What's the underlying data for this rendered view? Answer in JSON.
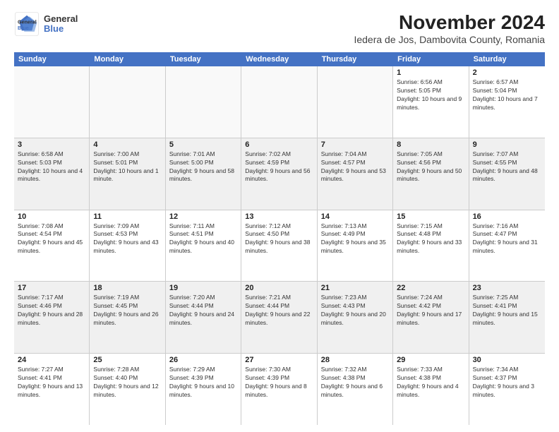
{
  "header": {
    "logo_general": "General",
    "logo_blue": "Blue",
    "title": "November 2024",
    "subtitle": "Iedera de Jos, Dambovita County, Romania"
  },
  "weekdays": [
    "Sunday",
    "Monday",
    "Tuesday",
    "Wednesday",
    "Thursday",
    "Friday",
    "Saturday"
  ],
  "rows": [
    [
      {
        "day": "",
        "info": ""
      },
      {
        "day": "",
        "info": ""
      },
      {
        "day": "",
        "info": ""
      },
      {
        "day": "",
        "info": ""
      },
      {
        "day": "",
        "info": ""
      },
      {
        "day": "1",
        "info": "Sunrise: 6:56 AM\nSunset: 5:05 PM\nDaylight: 10 hours and 9 minutes."
      },
      {
        "day": "2",
        "info": "Sunrise: 6:57 AM\nSunset: 5:04 PM\nDaylight: 10 hours and 7 minutes."
      }
    ],
    [
      {
        "day": "3",
        "info": "Sunrise: 6:58 AM\nSunset: 5:03 PM\nDaylight: 10 hours and 4 minutes."
      },
      {
        "day": "4",
        "info": "Sunrise: 7:00 AM\nSunset: 5:01 PM\nDaylight: 10 hours and 1 minute."
      },
      {
        "day": "5",
        "info": "Sunrise: 7:01 AM\nSunset: 5:00 PM\nDaylight: 9 hours and 58 minutes."
      },
      {
        "day": "6",
        "info": "Sunrise: 7:02 AM\nSunset: 4:59 PM\nDaylight: 9 hours and 56 minutes."
      },
      {
        "day": "7",
        "info": "Sunrise: 7:04 AM\nSunset: 4:57 PM\nDaylight: 9 hours and 53 minutes."
      },
      {
        "day": "8",
        "info": "Sunrise: 7:05 AM\nSunset: 4:56 PM\nDaylight: 9 hours and 50 minutes."
      },
      {
        "day": "9",
        "info": "Sunrise: 7:07 AM\nSunset: 4:55 PM\nDaylight: 9 hours and 48 minutes."
      }
    ],
    [
      {
        "day": "10",
        "info": "Sunrise: 7:08 AM\nSunset: 4:54 PM\nDaylight: 9 hours and 45 minutes."
      },
      {
        "day": "11",
        "info": "Sunrise: 7:09 AM\nSunset: 4:53 PM\nDaylight: 9 hours and 43 minutes."
      },
      {
        "day": "12",
        "info": "Sunrise: 7:11 AM\nSunset: 4:51 PM\nDaylight: 9 hours and 40 minutes."
      },
      {
        "day": "13",
        "info": "Sunrise: 7:12 AM\nSunset: 4:50 PM\nDaylight: 9 hours and 38 minutes."
      },
      {
        "day": "14",
        "info": "Sunrise: 7:13 AM\nSunset: 4:49 PM\nDaylight: 9 hours and 35 minutes."
      },
      {
        "day": "15",
        "info": "Sunrise: 7:15 AM\nSunset: 4:48 PM\nDaylight: 9 hours and 33 minutes."
      },
      {
        "day": "16",
        "info": "Sunrise: 7:16 AM\nSunset: 4:47 PM\nDaylight: 9 hours and 31 minutes."
      }
    ],
    [
      {
        "day": "17",
        "info": "Sunrise: 7:17 AM\nSunset: 4:46 PM\nDaylight: 9 hours and 28 minutes."
      },
      {
        "day": "18",
        "info": "Sunrise: 7:19 AM\nSunset: 4:45 PM\nDaylight: 9 hours and 26 minutes."
      },
      {
        "day": "19",
        "info": "Sunrise: 7:20 AM\nSunset: 4:44 PM\nDaylight: 9 hours and 24 minutes."
      },
      {
        "day": "20",
        "info": "Sunrise: 7:21 AM\nSunset: 4:44 PM\nDaylight: 9 hours and 22 minutes."
      },
      {
        "day": "21",
        "info": "Sunrise: 7:23 AM\nSunset: 4:43 PM\nDaylight: 9 hours and 20 minutes."
      },
      {
        "day": "22",
        "info": "Sunrise: 7:24 AM\nSunset: 4:42 PM\nDaylight: 9 hours and 17 minutes."
      },
      {
        "day": "23",
        "info": "Sunrise: 7:25 AM\nSunset: 4:41 PM\nDaylight: 9 hours and 15 minutes."
      }
    ],
    [
      {
        "day": "24",
        "info": "Sunrise: 7:27 AM\nSunset: 4:41 PM\nDaylight: 9 hours and 13 minutes."
      },
      {
        "day": "25",
        "info": "Sunrise: 7:28 AM\nSunset: 4:40 PM\nDaylight: 9 hours and 12 minutes."
      },
      {
        "day": "26",
        "info": "Sunrise: 7:29 AM\nSunset: 4:39 PM\nDaylight: 9 hours and 10 minutes."
      },
      {
        "day": "27",
        "info": "Sunrise: 7:30 AM\nSunset: 4:39 PM\nDaylight: 9 hours and 8 minutes."
      },
      {
        "day": "28",
        "info": "Sunrise: 7:32 AM\nSunset: 4:38 PM\nDaylight: 9 hours and 6 minutes."
      },
      {
        "day": "29",
        "info": "Sunrise: 7:33 AM\nSunset: 4:38 PM\nDaylight: 9 hours and 4 minutes."
      },
      {
        "day": "30",
        "info": "Sunrise: 7:34 AM\nSunset: 4:37 PM\nDaylight: 9 hours and 3 minutes."
      }
    ]
  ]
}
